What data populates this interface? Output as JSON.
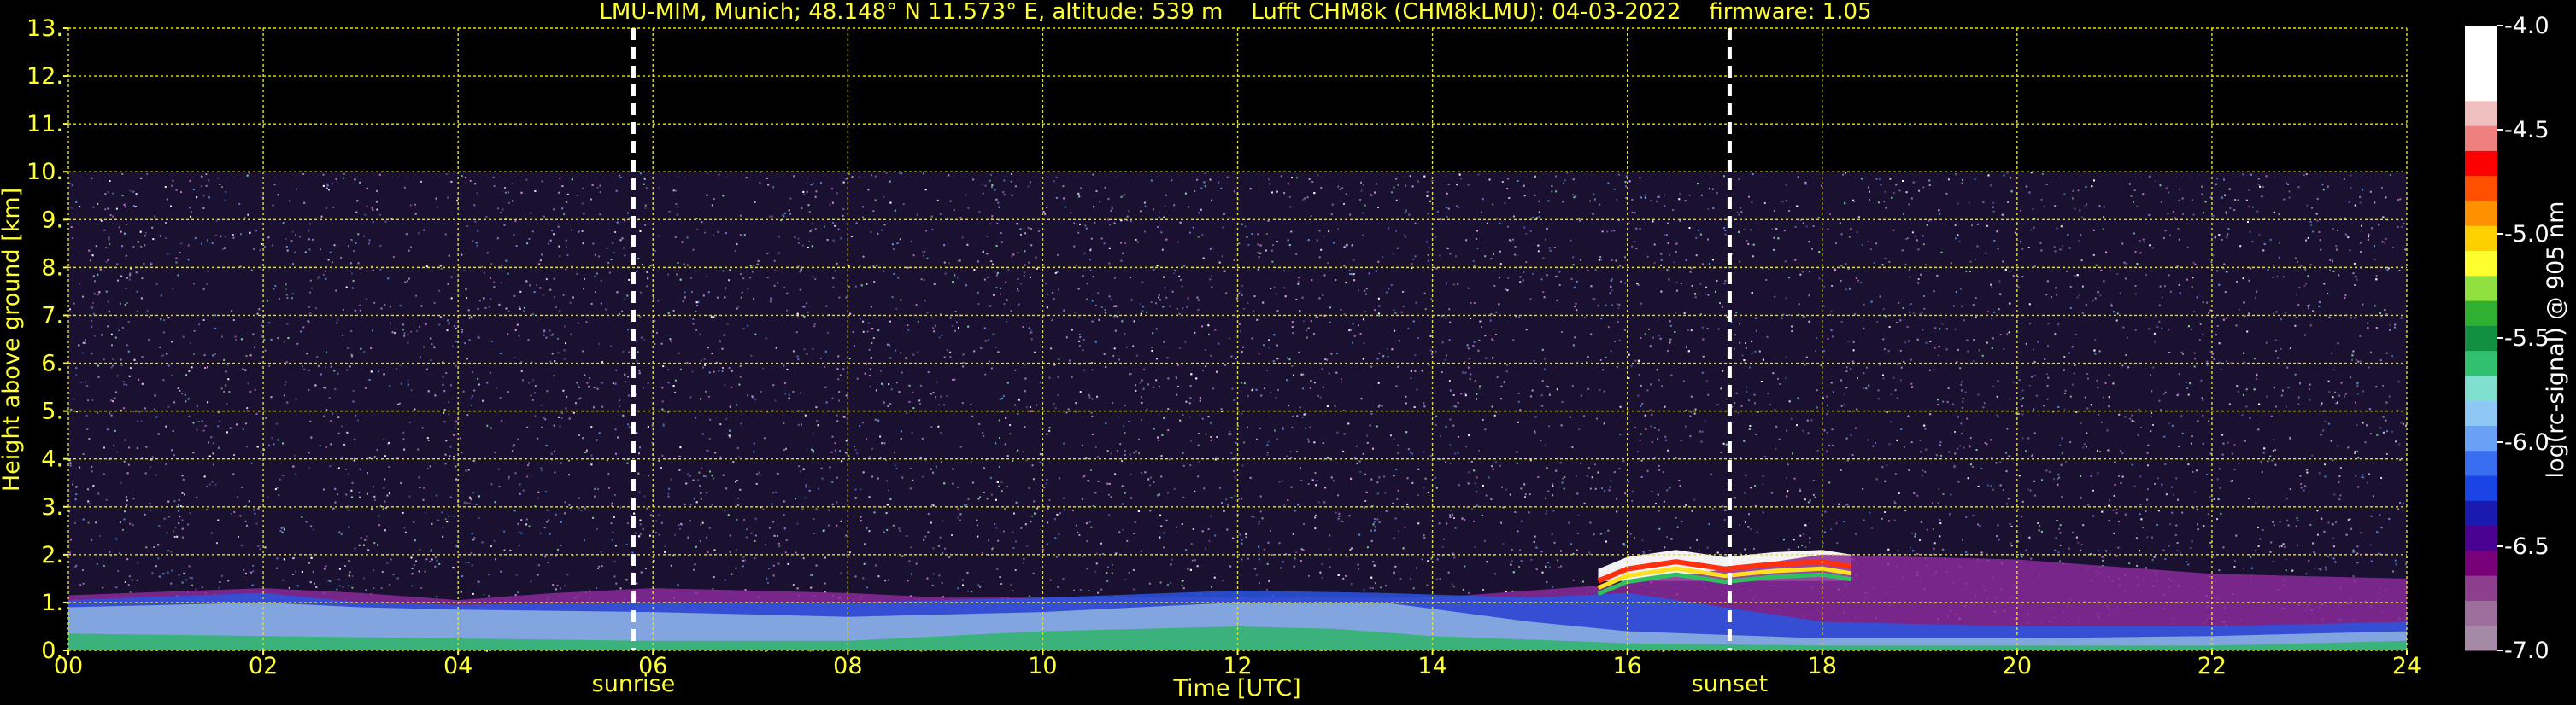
{
  "chart_data": {
    "type": "heatmap",
    "title": "LMU-MIM, Munich; 48.148° N 11.573° E, altitude: 539 m    Lufft CHM8k (CHM8kLMU): 04-03-2022    firmware: 1.05",
    "xlabel": "Time [UTC]",
    "ylabel": "Height above ground [km]",
    "xlim": [
      0,
      24
    ],
    "ylim": [
      0,
      13
    ],
    "x_ticks": [
      "00",
      "02",
      "04",
      "06",
      "08",
      "10",
      "12",
      "14",
      "16",
      "18",
      "20",
      "22",
      "24"
    ],
    "x_tick_values": [
      0,
      2,
      4,
      6,
      8,
      10,
      12,
      14,
      16,
      18,
      20,
      22,
      24
    ],
    "y_ticks": [
      "0.",
      "1.",
      "2.",
      "3.",
      "4.",
      "5.",
      "6.",
      "7.",
      "8.",
      "9.",
      "10.",
      "11.",
      "12.",
      "13."
    ],
    "y_tick_values": [
      0,
      1,
      2,
      3,
      4,
      5,
      6,
      7,
      8,
      9,
      10,
      11,
      12,
      13
    ],
    "grid": true,
    "noise_top_km": 10,
    "annotations": [
      {
        "label": "sunrise",
        "x": 5.8
      },
      {
        "label": "sunset",
        "x": 17.05
      }
    ],
    "colorbar": {
      "label": "log(rc-signal) @ 905 nm",
      "range": [
        -7.0,
        -4.0
      ],
      "ticks": [
        "-4.0",
        "-4.5",
        "-5.0",
        "-5.5",
        "-6.0",
        "-6.5",
        "-7.0"
      ],
      "tick_values": [
        -4.0,
        -4.5,
        -5.0,
        -5.5,
        -6.0,
        -6.5,
        -7.0
      ],
      "colors": [
        "#a58aa5",
        "#9d6f9d",
        "#8c3f8c",
        "#7a007a",
        "#4a0090",
        "#1a1ab0",
        "#1a44e6",
        "#3a6ef0",
        "#6aa0f5",
        "#8fc8f5",
        "#7fe0d0",
        "#30c070",
        "#109040",
        "#30b030",
        "#90e040",
        "#ffff30",
        "#ffd000",
        "#ff9000",
        "#ff5000",
        "#ff0000",
        "#f08080",
        "#f0c0c0",
        "#ffffff",
        "#ffffff",
        "#ffffff"
      ]
    },
    "layers": [
      {
        "name": "boundary-layer-base",
        "color": "#2fb56a",
        "points": [
          [
            0,
            0.35
          ],
          [
            2,
            0.3
          ],
          [
            4,
            0.25
          ],
          [
            6,
            0.2
          ],
          [
            8,
            0.2
          ],
          [
            10,
            0.4
          ],
          [
            12,
            0.5
          ],
          [
            13,
            0.45
          ],
          [
            14,
            0.3
          ],
          [
            16,
            0.15
          ],
          [
            18,
            0.1
          ],
          [
            20,
            0.1
          ],
          [
            22,
            0.1
          ],
          [
            24,
            0.2
          ]
        ]
      },
      {
        "name": "aerosol-light-blue",
        "color": "#8fb4e0",
        "points": [
          [
            0,
            0.9
          ],
          [
            2,
            1.0
          ],
          [
            3,
            0.9
          ],
          [
            4,
            0.85
          ],
          [
            6,
            0.8
          ],
          [
            8,
            0.7
          ],
          [
            10,
            0.8
          ],
          [
            12,
            1.0
          ],
          [
            13.5,
            1.0
          ],
          [
            15,
            0.6
          ],
          [
            16,
            0.4
          ],
          [
            18,
            0.25
          ],
          [
            20,
            0.25
          ],
          [
            22,
            0.3
          ],
          [
            24,
            0.4
          ]
        ]
      },
      {
        "name": "aerosol-blue",
        "color": "#2a56e0",
        "points": [
          [
            0,
            1.05
          ],
          [
            2,
            1.2
          ],
          [
            3,
            1.0
          ],
          [
            4,
            0.95
          ],
          [
            6,
            1.0
          ],
          [
            8,
            1.0
          ],
          [
            10,
            1.1
          ],
          [
            12,
            1.25
          ],
          [
            13.5,
            1.2
          ],
          [
            15,
            1.1
          ],
          [
            16,
            1.2
          ],
          [
            17,
            0.9
          ],
          [
            18,
            0.6
          ],
          [
            20,
            0.5
          ],
          [
            22,
            0.5
          ],
          [
            24,
            0.6
          ]
        ]
      },
      {
        "name": "residual-purple",
        "color": "#8a2a9a",
        "points": [
          [
            0,
            1.15
          ],
          [
            2,
            1.3
          ],
          [
            3,
            1.2
          ],
          [
            4,
            1.05
          ],
          [
            5,
            1.2
          ],
          [
            6,
            1.3
          ],
          [
            8,
            1.2
          ],
          [
            9,
            1.1
          ],
          [
            12,
            1.1
          ],
          [
            14,
            1.1
          ],
          [
            16,
            1.4
          ],
          [
            17,
            1.7
          ],
          [
            18,
            2.0
          ],
          [
            20,
            1.9
          ],
          [
            22,
            1.6
          ],
          [
            24,
            1.5
          ]
        ]
      },
      {
        "name": "cloud-white",
        "color": "#ffffff",
        "points": [
          [
            15.7,
            1.7
          ],
          [
            16,
            1.95
          ],
          [
            16.5,
            2.1
          ],
          [
            17,
            1.95
          ],
          [
            17.5,
            2.05
          ],
          [
            18,
            2.1
          ],
          [
            18.3,
            2.0
          ]
        ]
      }
    ]
  }
}
